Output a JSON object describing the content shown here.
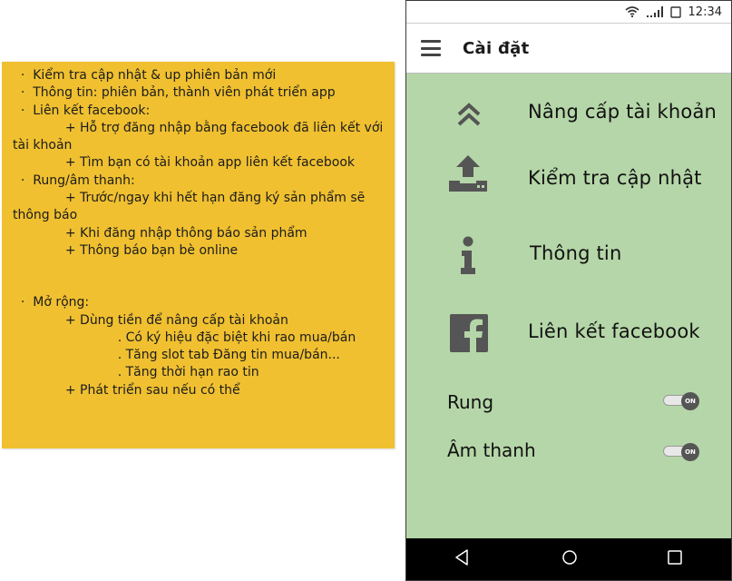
{
  "note": {
    "lines": [
      {
        "text": "  ·  Kiểm tra cập nhật & up phiên bản mới"
      },
      {
        "text": "  ·  Thông tin: phiên bản, thành viên phát triển app"
      },
      {
        "text": "  ·  Liên kết facebook:"
      },
      {
        "text": "             + Hỗ trợ đăng nhập bằng facebook đã liên kết với"
      },
      {
        "text": "tài khoản"
      },
      {
        "text": "             + Tìm bạn có tài khoản app liên kết facebook"
      },
      {
        "text": "  ·  Rung/âm thanh:"
      },
      {
        "text": "             + Trước/ngay khi hết hạn đăng ký sản phẩm sẽ"
      },
      {
        "text": "thông báo"
      },
      {
        "text": "             + Khi đăng nhập thông báo sản phẩm"
      },
      {
        "text": "             + Thông báo bạn bè online"
      }
    ],
    "lines2": [
      {
        "text": "  ·  Mở rộng:"
      },
      {
        "text": "             + Dùng tiền để nâng cấp tài khoản"
      },
      {
        "text": "                          . Có ký hiệu đặc biệt khi rao mua/bán"
      },
      {
        "text": "                          . Tăng slot tab Đăng tin mua/bán..."
      },
      {
        "text": "                          . Tăng thời hạn rao tin"
      },
      {
        "text": "             + Phát triển sau nếu có thể"
      }
    ]
  },
  "status_bar": {
    "time": "12:34",
    "icons": [
      "wifi-icon",
      "signal-icon",
      "battery-icon"
    ]
  },
  "app_bar": {
    "title": "Cài đặt"
  },
  "menu": [
    {
      "label": "Nâng cấp tài khoản",
      "icon": "double-chevron-up-icon"
    },
    {
      "label": "Kiểm tra cập nhật",
      "icon": "upload-icon"
    },
    {
      "label": "Thông tin",
      "icon": "info-icon"
    },
    {
      "label": "Liên kết facebook",
      "icon": "facebook-icon"
    }
  ],
  "toggles": [
    {
      "label": "Rung",
      "state": "ON"
    },
    {
      "label": "Âm thanh",
      "state": "ON"
    }
  ],
  "colors": {
    "note_bg": "#f0c030",
    "screen_bg": "#b5d6a8",
    "icon_gray": "#555555",
    "nav_bg": "#000000"
  }
}
